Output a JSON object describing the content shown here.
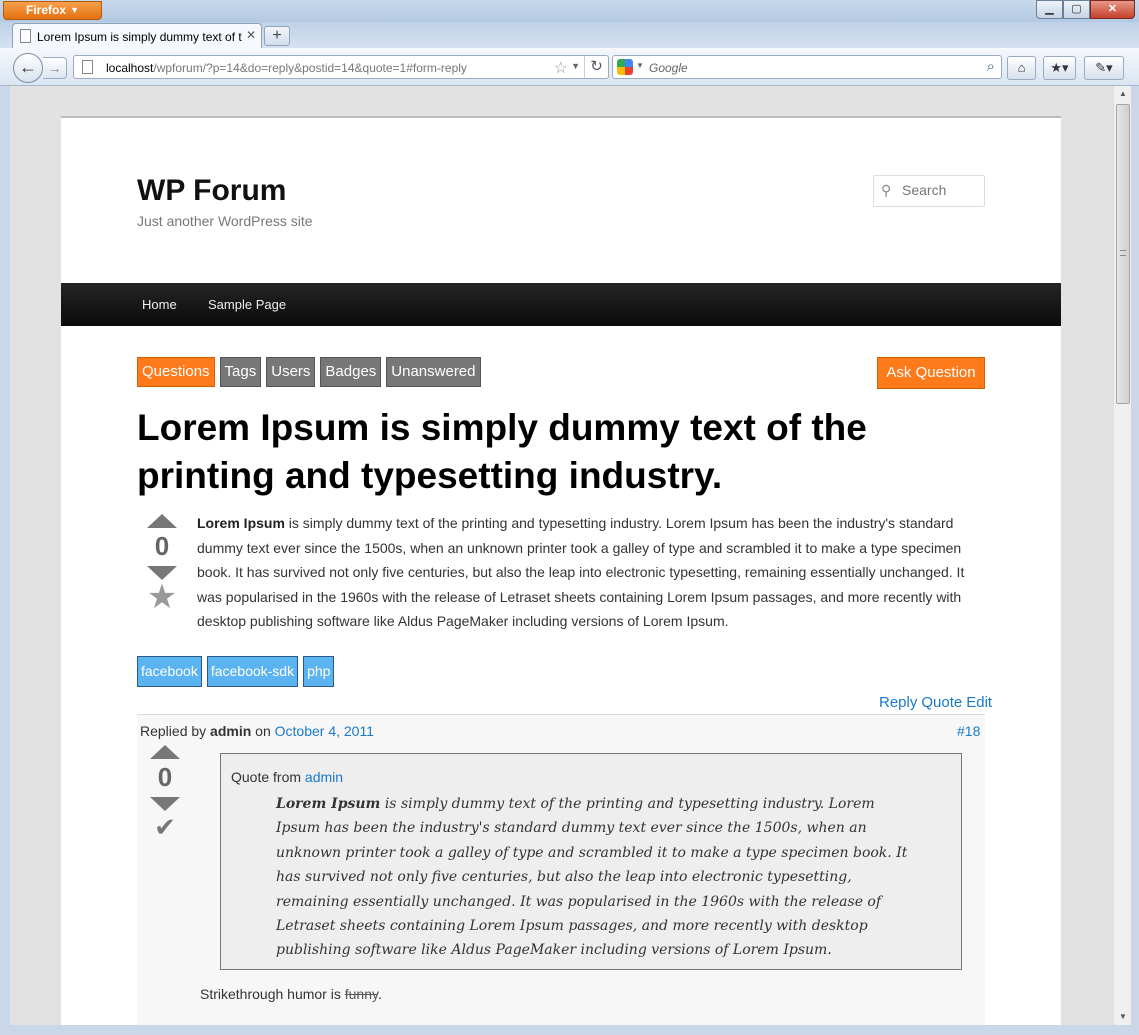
{
  "browser": {
    "menu_button": "Firefox",
    "tab_title": "Lorem Ipsum is simply dummy text of the printing and typesetting industry.",
    "url_host": "localhost",
    "url_path": "/wpforum/?p=14&do=reply&postid=14&quote=1#form-reply",
    "search_engine": "Google"
  },
  "site": {
    "title": "WP Forum",
    "tagline": "Just another WordPress site",
    "search_placeholder": "Search"
  },
  "menu": {
    "items": [
      "Home",
      "Sample Page"
    ]
  },
  "forum_nav": {
    "items": [
      "Questions",
      "Tags",
      "Users",
      "Badges",
      "Unanswered"
    ],
    "active": "Questions",
    "ask_label": "Ask Question",
    "accent_color": "#ff7a1a"
  },
  "question": {
    "title": "Lorem Ipsum is simply dummy text of the printing and typesetting industry.",
    "votes": "0",
    "body_lead": "Lorem Ipsum",
    "body_rest": " is simply dummy text of the printing and typesetting industry. Lorem Ipsum has been the industry's standard dummy text ever since the 1500s, when an unknown printer took a galley of type and scrambled it to make a type specimen book. It has survived not only five centuries, but also the leap into electronic typesetting, remaining essentially unchanged. It was popularised in the 1960s with the release of Letraset sheets containing Lorem Ipsum passages, and more recently with desktop publishing software like Aldus PageMaker including versions of Lorem Ipsum.",
    "tags": [
      "facebook",
      "facebook-sdk",
      "php"
    ],
    "tag_color": "#5cb3f2",
    "actions": [
      "Reply",
      "Quote",
      "Edit"
    ]
  },
  "reply": {
    "prefix": "Replied by",
    "author": "admin",
    "on": "on",
    "date": "October 4, 2011",
    "number": "#18",
    "votes": "0",
    "quote_prefix": "Quote from",
    "quote_author": "admin",
    "quote_lead": "Lorem Ipsum",
    "quote_rest": " is simply dummy text of the printing and typesetting industry. Lorem Ipsum has been the industry's standard dummy text ever since the 1500s, when an unknown printer took a galley of type and scrambled it to make a type specimen book. It has survived not only five centuries, but also the leap into electronic typesetting, remaining essentially unchanged. It was popularised in the 1960s with the release of Letraset sheets containing Lorem Ipsum passages, and more recently with desktop publishing software like Aldus PageMaker including versions of Lorem Ipsum.",
    "strike_text": "Strikethrough humor is",
    "strike_word": "funny",
    "strike_end": "."
  }
}
